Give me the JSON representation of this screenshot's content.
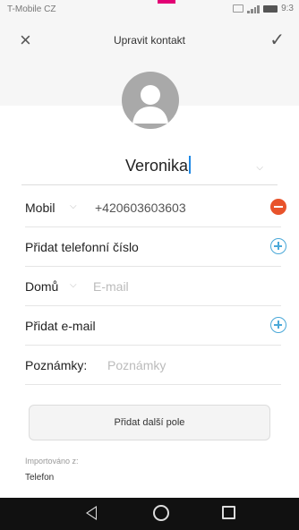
{
  "status_bar": {
    "carrier": "T-Mobile CZ",
    "time": "9:3"
  },
  "header": {
    "title": "Upravit kontakt",
    "close_icon": "close-icon",
    "confirm_icon": "check-icon"
  },
  "contact": {
    "name": "Veronika"
  },
  "fields": {
    "phone": {
      "label": "Mobil",
      "value": "+420603603603"
    },
    "add_phone_label": "Přidat telefonní číslo",
    "email": {
      "label": "Domů",
      "placeholder": "E-mail"
    },
    "add_email_label": "Přidat e-mail",
    "notes": {
      "label": "Poznámky:",
      "placeholder": "Poznámky"
    }
  },
  "add_field_button": "Přidat další pole",
  "import": {
    "label": "Importováno z:",
    "value": "Telefon"
  },
  "nav": {
    "back_icon": "back-icon",
    "home_icon": "home-icon",
    "recent_icon": "recent-apps-icon"
  },
  "colors": {
    "accent": "#4aa8d8",
    "remove": "#e8532b",
    "brand": "#e20074"
  }
}
